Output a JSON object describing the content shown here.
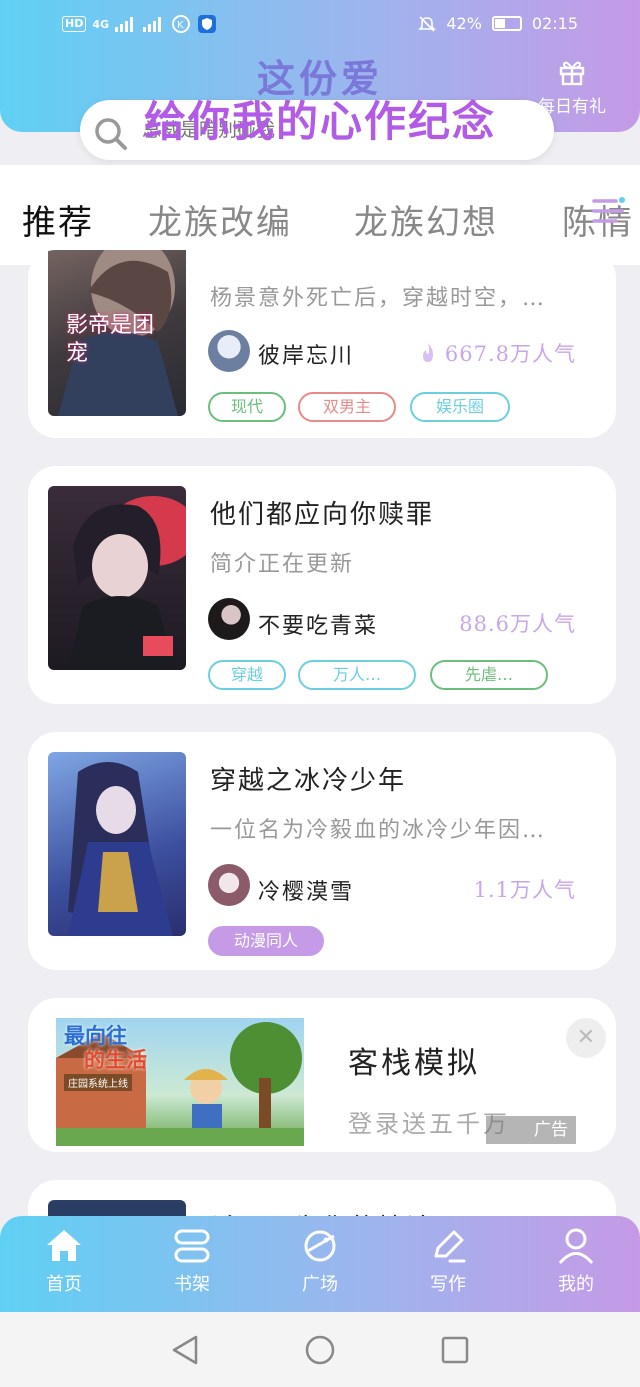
{
  "status_bar": {
    "network": "HD",
    "signal": "4G",
    "battery": "42%",
    "battery_level": 0.42,
    "time": "02:15"
  },
  "banner": {
    "line1": "这份爱",
    "line2": "给你我的心作纪念"
  },
  "gift": {
    "label": "每日有礼"
  },
  "search": {
    "placeholder": "总裁是暗别碰我"
  },
  "tabs": [
    {
      "label": "推荐",
      "active": true
    },
    {
      "label": "龙族改编",
      "active": false
    },
    {
      "label": "龙族幻想",
      "active": false
    },
    {
      "label": "陈情",
      "active": false
    }
  ],
  "books": [
    {
      "title": "影帝是团宠",
      "desc": "杨景意外死亡后，穿越时空，…",
      "author": "彼岸忘川",
      "popularity": "667.8万人气",
      "tags": [
        {
          "label": "现代",
          "color": "#6cbf7b"
        },
        {
          "label": "双男主",
          "color": "#e68a8a"
        },
        {
          "label": "娱乐圈",
          "color": "#6ccfe0"
        }
      ],
      "cover_text": "影帝是团宠"
    },
    {
      "title": "他们都应向你赎罪",
      "desc": "简介正在更新",
      "author": "不要吃青菜",
      "popularity": "88.6万人气",
      "tags": [
        {
          "label": "穿越",
          "color": "#6ccfe0"
        },
        {
          "label": "万人…",
          "color": "#6ccfe0"
        },
        {
          "label": "先虐…",
          "color": "#6cbf7b"
        }
      ]
    },
    {
      "title": "穿越之冰冷少年",
      "desc": "一位名为冷毅血的冰冷少年因…",
      "author": "冷樱漠雪",
      "popularity": "1.1万人气",
      "tags": [
        {
          "label": "动漫同人",
          "color": "#c59ae6"
        }
      ]
    }
  ],
  "ad": {
    "title": "客栈模拟",
    "subtitle": "登录送五千万",
    "mark": "广告",
    "banner_line1": "最向往",
    "banner_line2": "的生活",
    "banner_line3": "庄园系统上线"
  },
  "peek_card": {
    "title": "杀了因为你的悖论"
  },
  "bottom_nav": [
    {
      "label": "首页",
      "icon": "home-icon"
    },
    {
      "label": "书架",
      "icon": "bookshelf-icon"
    },
    {
      "label": "广场",
      "icon": "planet-icon"
    },
    {
      "label": "写作",
      "icon": "pen-icon"
    },
    {
      "label": "我的",
      "icon": "user-icon"
    }
  ],
  "colors": {
    "gradient_start": "#5fd0f3",
    "gradient_end": "#c59ae6",
    "popularity": "#c8a6ea"
  }
}
